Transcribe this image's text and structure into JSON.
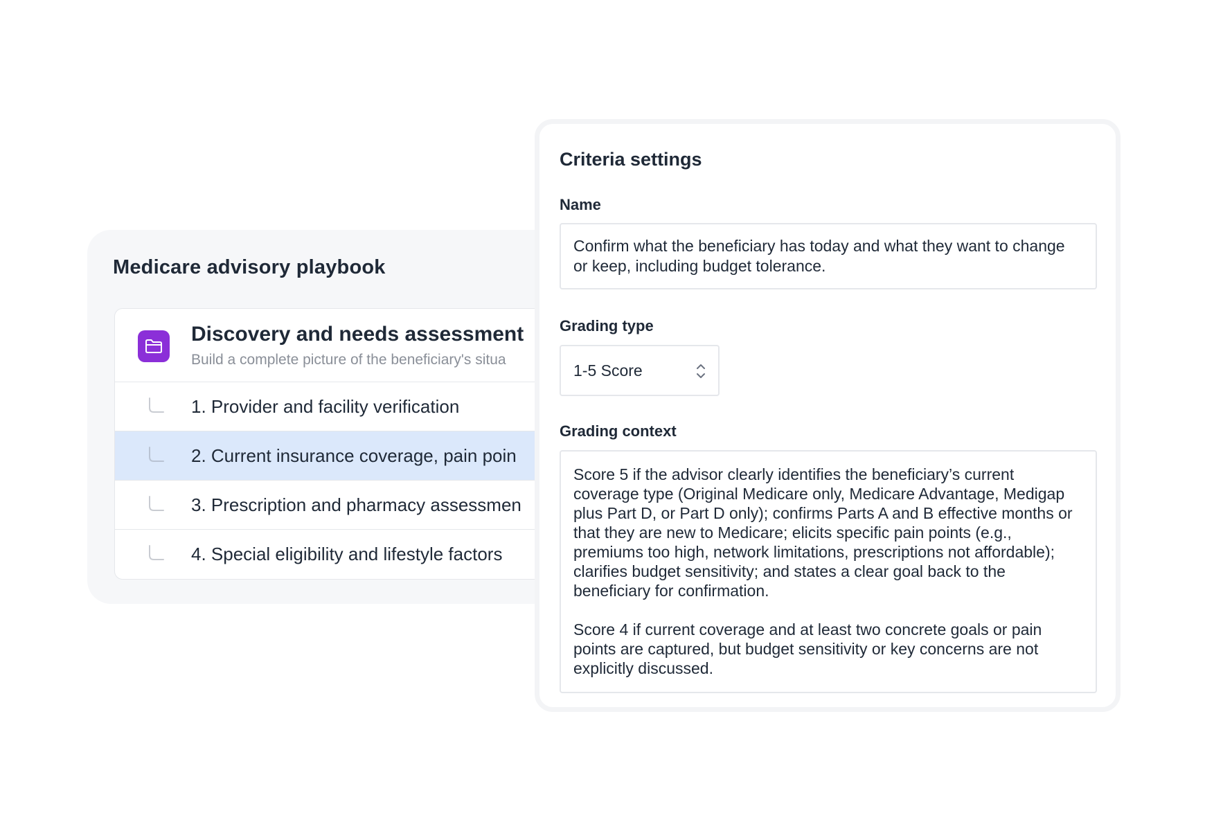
{
  "playbook": {
    "title": "Medicare advisory playbook",
    "section": {
      "icon": "folder-icon",
      "title": "Discovery and needs assessment",
      "subtitle": "Build a complete picture of the beneficiary's situa"
    },
    "items": [
      {
        "label": "1. Provider and facility verification",
        "selected": false
      },
      {
        "label": "2. Current insurance coverage, pain poin",
        "selected": true
      },
      {
        "label": "3. Prescription and pharmacy assessmen",
        "selected": false
      },
      {
        "label": "4. Special eligibility and lifestyle factors",
        "selected": false
      }
    ]
  },
  "criteria": {
    "title": "Criteria settings",
    "name_label": "Name",
    "name_value": "Confirm what the beneficiary has today and what they want to change or keep, including budget tolerance.",
    "grading_type_label": "Grading type",
    "grading_type_value": "1-5 Score",
    "grading_context_label": "Grading context",
    "grading_context_paragraphs": [
      "Score 5 if the advisor clearly identifies the beneficiary’s current coverage type (Original Medicare only, Medicare Advantage, Medigap plus Part D, or Part D only); confirms Parts A and B effective months or that they are new to Medicare; elicits specific pain points (e.g., premiums too high, network limitations, prescriptions not affordable); clarifies budget sensitivity; and states a clear goal back to the beneficiary for confirmation.",
      "Score 4 if current coverage and at least two concrete goals or pain points are captured, but budget sensitivity or key concerns are not explicitly discussed."
    ]
  },
  "colors": {
    "accent_purple": "#8b2fd8",
    "selected_row": "#dbe8fb",
    "card_bg": "#f6f7f9"
  }
}
